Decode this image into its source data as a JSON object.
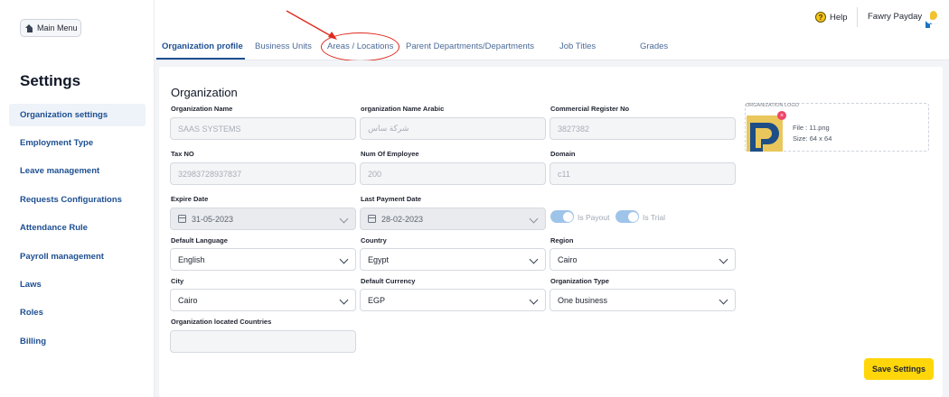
{
  "sidebar": {
    "main_menu": "Main Menu",
    "title": "Settings",
    "items": [
      {
        "label": "Organization settings"
      },
      {
        "label": "Employment Type"
      },
      {
        "label": "Leave management"
      },
      {
        "label": "Requests Configurations"
      },
      {
        "label": "Attendance Rule"
      },
      {
        "label": "Payroll management"
      },
      {
        "label": "Laws"
      },
      {
        "label": "Roles"
      },
      {
        "label": "Billing"
      }
    ]
  },
  "header": {
    "help": "Help",
    "company": "Fawry Payday"
  },
  "tabs": [
    {
      "label": "Organization profile"
    },
    {
      "label": "Business Units"
    },
    {
      "label": "Areas / Locations"
    },
    {
      "label": "Parent Departments/Departments"
    },
    {
      "label": "Job Titles"
    },
    {
      "label": "Grades"
    }
  ],
  "form": {
    "title": "Organization",
    "org_name": {
      "label": "Organization Name",
      "value": "SAAS SYSTEMS"
    },
    "org_name_ar": {
      "label": "organization Name Arabic",
      "value": "شركة ساس"
    },
    "commercial_reg": {
      "label": "Commercial Register No",
      "value": "3827382"
    },
    "tax_no": {
      "label": "Tax NO",
      "value": "32983728937837"
    },
    "num_employee": {
      "label": "Num Of Employee",
      "value": "200"
    },
    "domain": {
      "label": "Domain",
      "value": "c11"
    },
    "expire_date": {
      "label": "Expire Date",
      "value": "31-05-2023"
    },
    "last_payment": {
      "label": "Last Payment Date",
      "value": "28-02-2023"
    },
    "is_payout": {
      "label": "Is Payout",
      "on": true
    },
    "is_trial": {
      "label": "Is Trial",
      "on": true
    },
    "default_language": {
      "label": "Default Language",
      "value": "English"
    },
    "country": {
      "label": "Country",
      "value": "Egypt"
    },
    "region": {
      "label": "Region",
      "value": "Cairo"
    },
    "city": {
      "label": "City",
      "value": "Cairo"
    },
    "default_currency": {
      "label": "Default Currency",
      "value": "EGP"
    },
    "org_type": {
      "label": "Organization Type",
      "value": "One business"
    },
    "located_countries": {
      "label": "Organization located Countries",
      "value": ""
    }
  },
  "logo": {
    "label": "ORGANIZATION LOGO",
    "file": "File : 11.png",
    "size": "Size: 64 x 64"
  },
  "save_button": "Save Settings",
  "colors": {
    "accent": "#1d4f91",
    "save": "#ffd60a",
    "annotation": "#e0281d"
  }
}
